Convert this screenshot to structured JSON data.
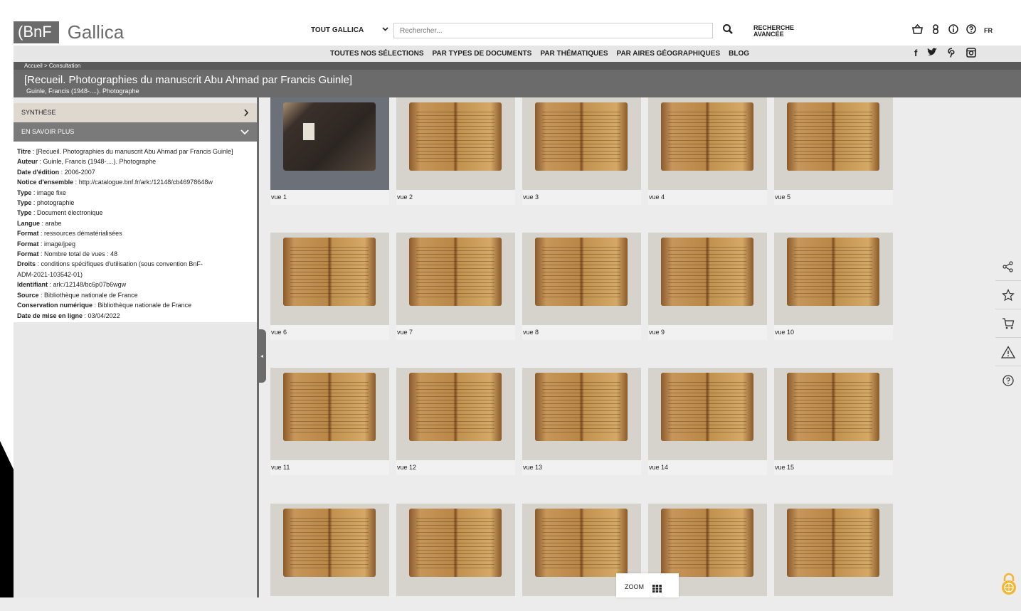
{
  "header": {
    "logo_bnf": "(BnF",
    "logo_gallica": "Gallica",
    "scope": "TOUT GALLICA",
    "search_placeholder": "Rechercher...",
    "advanced_line1": "RECHERCHE",
    "advanced_line2": "AVANCÉE",
    "lang": "FR"
  },
  "nav": {
    "links": [
      "TOUTES NOS SÉLECTIONS",
      "PAR TYPES DE DOCUMENTS",
      "PAR THÉMATIQUES",
      "PAR AIRES GÉOGRAPHIQUES",
      "BLOG"
    ]
  },
  "breadcrumb": "Accueil > Consultation",
  "document": {
    "title": "[Recueil. Photographies du manuscrit Abu Ahmad par Francis Guinle]",
    "subtitle": "Guinle, Francis (1948-....). Photographe"
  },
  "panel": {
    "synthese": "SYNTHÈSE",
    "en_savoir_plus": "EN SAVOIR PLUS",
    "meta": [
      {
        "label": "Titre",
        "value": "[Recueil. Photographies du manuscrit Abu Ahmad par Francis Guinle]"
      },
      {
        "label": "Auteur",
        "value": "Guinle, Francis (1948-....). Photographe"
      },
      {
        "label": "Date d'édition",
        "value": "2006-2007"
      },
      {
        "label": "Notice d'ensemble",
        "value": "http://catalogue.bnf.fr/ark:/12148/cb46978648w"
      },
      {
        "label": "Type",
        "value": "image fixe"
      },
      {
        "label": "Type",
        "value": "photographie"
      },
      {
        "label": "Type",
        "value": "Document électronique"
      },
      {
        "label": "Langue",
        "value": "arabe"
      },
      {
        "label": "Format",
        "value": "ressources dématérialisées"
      },
      {
        "label": "Format",
        "value": "image/jpeg"
      },
      {
        "label": "Format",
        "value": "Nombre total de vues : 48"
      },
      {
        "label": "Droits",
        "value": "conditions spécifiques d'utilisation (sous convention BnF-"
      },
      {
        "label": "",
        "value": "ADM-2021-103542-01)"
      },
      {
        "label": "Identifiant",
        "value": "ark:/12148/bc6p07b6wgw"
      },
      {
        "label": "Source",
        "value": "Bibliothèque nationale de France"
      },
      {
        "label": "Conservation numérique",
        "value": "Bibliothèque nationale de France"
      },
      {
        "label": "Date de mise en ligne",
        "value": "03/04/2022"
      }
    ]
  },
  "views": [
    "vue 1",
    "vue 2",
    "vue 3",
    "vue 4",
    "vue 5",
    "vue 6",
    "vue 7",
    "vue 8",
    "vue 9",
    "vue 10",
    "vue 11",
    "vue 12",
    "vue 13",
    "vue 14",
    "vue 15",
    "",
    "",
    "",
    "",
    ""
  ],
  "zoom_label": "ZOOM",
  "colors": {
    "header_gray": "#6b6b6b",
    "panel_beige": "#ded8cf",
    "selected_thumb": "#6b7079",
    "lock_yellow": "#f2b632"
  }
}
